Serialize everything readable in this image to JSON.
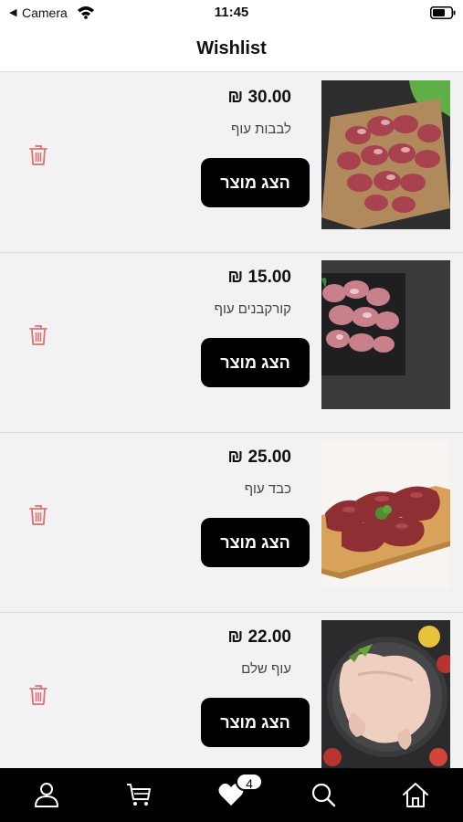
{
  "status_bar": {
    "back_glyph": "◀",
    "carrier": "Camera",
    "time": "11:45",
    "icons": [
      "wifi-icon",
      "battery-icon"
    ]
  },
  "header": {
    "title": "Wishlist"
  },
  "wishlist": {
    "items": [
      {
        "price": "₪ 30.00",
        "name": "לבבות עוף",
        "button_label": "הצג מוצר",
        "image": "chicken-hearts-photo"
      },
      {
        "price": "₪ 15.00",
        "name": "קורקבנים עוף",
        "button_label": "הצג מוצר",
        "image": "chicken-gizzards-photo"
      },
      {
        "price": "₪ 25.00",
        "name": "כבד עוף",
        "button_label": "הצג מוצר",
        "image": "chicken-liver-photo"
      },
      {
        "price": "₪ 22.00",
        "name": "עוף שלם",
        "button_label": "הצג מוצר",
        "image": "whole-chicken-photo"
      }
    ]
  },
  "tab_bar": {
    "tabs": [
      "user-icon",
      "cart-icon",
      "heart-icon",
      "search-icon",
      "home-icon"
    ],
    "wishlist_badge": "4"
  },
  "colors": {
    "accent_trash": "#e07070",
    "button_bg": "#000000",
    "tab_bar_bg": "#000000",
    "page_bg": "#f2f2f4"
  }
}
